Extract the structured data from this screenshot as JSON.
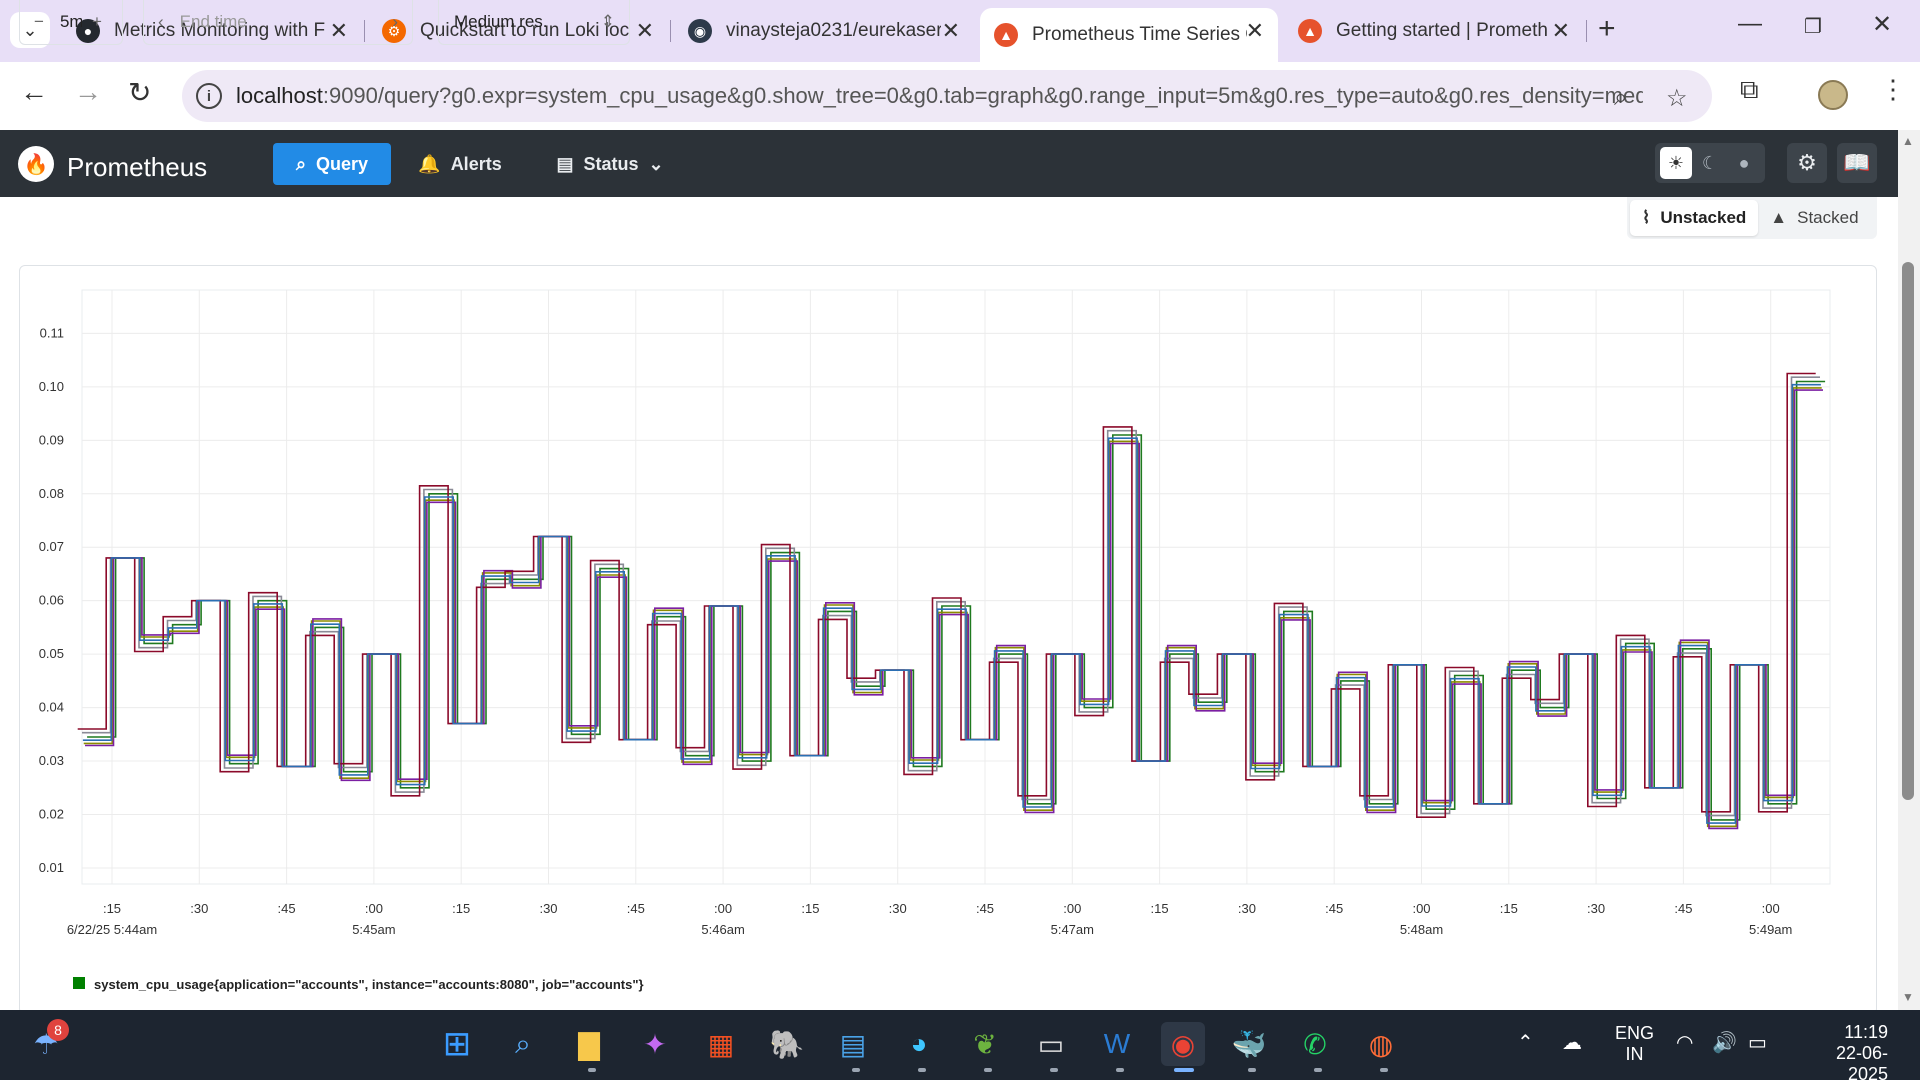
{
  "browser": {
    "tabs": [
      {
        "title": "Metrics Monitoring with F",
        "icon": "github-icon",
        "active": false
      },
      {
        "title": "Quickstart to run Loki loc",
        "icon": "grafana-icon",
        "active": false
      },
      {
        "title": "vinaysteja0231/eurekaser",
        "icon": "docker-icon",
        "active": false
      },
      {
        "title": "Prometheus Time Series C",
        "icon": "prometheus-icon",
        "active": true
      },
      {
        "title": "Getting started | Prometh",
        "icon": "prometheus-icon",
        "active": false
      }
    ],
    "url_host": "localhost",
    "url_rest": ":9090/query?g0.expr=system_cpu_usage&g0.show_tree=0&g0.tab=graph&g0.range_input=5m&g0.res_type=auto&g0.res_density=med..."
  },
  "prometheus_nav": {
    "brand": "Prometheus",
    "query_label": "Query",
    "alerts_label": "Alerts",
    "status_label": "Status"
  },
  "toolbar": {
    "range_value": "5m",
    "end_time_placeholder": "End time",
    "resolution": "Medium res.",
    "unstacked_label": "Unstacked",
    "stacked_label": "Stacked"
  },
  "legend": {
    "label": "system_cpu_usage{application=\"accounts\", instance=\"accounts:8080\", job=\"accounts\"}",
    "color": "#008000"
  },
  "taskbar": {
    "weather_badge": "8",
    "lang_top": "ENG",
    "lang_bottom": "IN",
    "time": "11:19",
    "date": "22-06-2025"
  },
  "chart_data": {
    "type": "line",
    "y_ticks": [
      "0.01",
      "0.02",
      "0.03",
      "0.04",
      "0.05",
      "0.06",
      "0.07",
      "0.08",
      "0.09",
      "0.10",
      "0.11"
    ],
    "ylim": [
      0.007,
      0.1155
    ],
    "x_ticks": [
      {
        "label": ":15",
        "sub": "6/22/25 5:44am"
      },
      {
        "label": ":30",
        "sub": ""
      },
      {
        "label": ":45",
        "sub": ""
      },
      {
        "label": ":00",
        "sub": "5:45am"
      },
      {
        "label": ":15",
        "sub": ""
      },
      {
        "label": ":30",
        "sub": ""
      },
      {
        "label": ":45",
        "sub": ""
      },
      {
        "label": ":00",
        "sub": "5:46am"
      },
      {
        "label": ":15",
        "sub": ""
      },
      {
        "label": ":30",
        "sub": ""
      },
      {
        "label": ":45",
        "sub": ""
      },
      {
        "label": ":00",
        "sub": "5:47am"
      },
      {
        "label": ":15",
        "sub": ""
      },
      {
        "label": ":30",
        "sub": ""
      },
      {
        "label": ":45",
        "sub": ""
      },
      {
        "label": ":00",
        "sub": "5:48am"
      },
      {
        "label": ":15",
        "sub": ""
      },
      {
        "label": ":30",
        "sub": ""
      },
      {
        "label": ":45",
        "sub": ""
      },
      {
        "label": ":00",
        "sub": "5:49am"
      }
    ],
    "base_series": [
      0.0345,
      0.068,
      0.052,
      0.0555,
      0.06,
      0.0295,
      0.06,
      0.029,
      0.055,
      0.028,
      0.05,
      0.025,
      0.08,
      0.037,
      0.064,
      0.064,
      0.072,
      0.035,
      0.066,
      0.034,
      0.057,
      0.031,
      0.059,
      0.03,
      0.069,
      0.031,
      0.058,
      0.044,
      0.047,
      0.029,
      0.059,
      0.034,
      0.05,
      0.022,
      0.05,
      0.04,
      0.091,
      0.03,
      0.05,
      0.041,
      0.05,
      0.028,
      0.058,
      0.029,
      0.045,
      0.022,
      0.048,
      0.021,
      0.046,
      0.022,
      0.047,
      0.04,
      0.05,
      0.023,
      0.052,
      0.025,
      0.051,
      0.019,
      0.048,
      0.022,
      0.101
    ],
    "series": [
      {
        "color": "#1f7a1f",
        "shift": 1.2
      },
      {
        "color": "#8b8b00",
        "shift": 0.4
      },
      {
        "color": "#8a8a96",
        "shift": 0.0
      },
      {
        "color": "#7b1fa2",
        "shift": 0.7
      },
      {
        "color": "#8b0a2a",
        "shift": -1.0
      },
      {
        "color": "#2b6fb3",
        "shift": 0.2
      }
    ]
  }
}
